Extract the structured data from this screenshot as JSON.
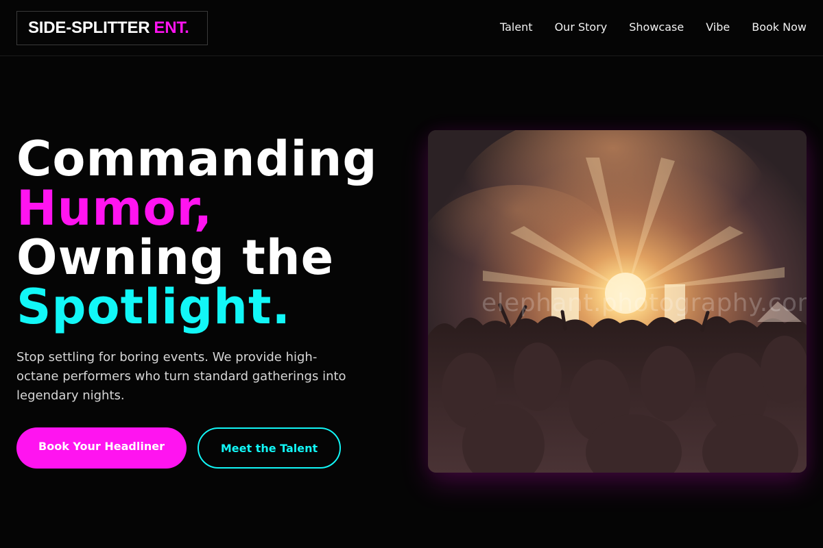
{
  "brand": {
    "name": "SIDE-SPLITTER",
    "suffix": "ENT.",
    "accent_color": "#ff14f0"
  },
  "nav": {
    "items": [
      "Talent",
      "Our Story",
      "Showcase",
      "Vibe",
      "Book Now"
    ]
  },
  "hero": {
    "title_line1": "Commanding",
    "title_line2": "Humor,",
    "title_line3": "Owning the",
    "title_line4": "Spotlight.",
    "description": "Stop settling for boring events. We provide high-octane performers who turn standard gatherings into legendary nights.",
    "primary_button": "Book Your Headliner",
    "secondary_button": "Meet the Talent",
    "colors": {
      "magenta": "#ff14f0",
      "cyan": "#12f7f7"
    }
  },
  "image": {
    "subject": "concert crowd in front of a stage with bright lights and smoke",
    "watermark": "elephant.photography.com"
  }
}
